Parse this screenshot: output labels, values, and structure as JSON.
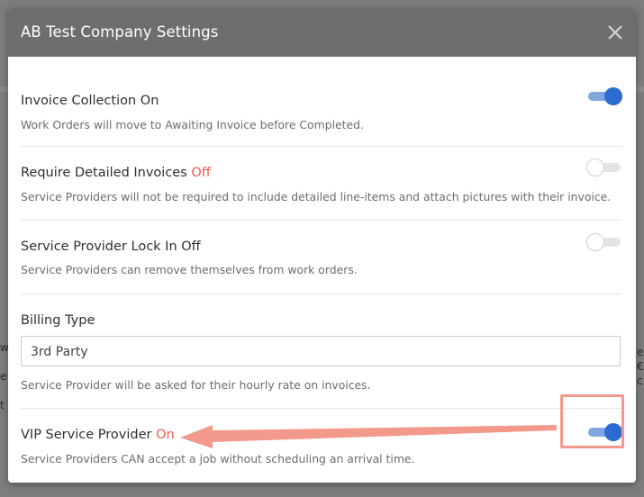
{
  "modal": {
    "title": "AB Test Company Settings",
    "close_icon": "close-x-icon"
  },
  "settings": [
    {
      "title": "Invoice Collection On",
      "status": "",
      "description": "Work Orders will move to Awaiting Invoice before Completed.",
      "enabled": true
    },
    {
      "title": "Require Detailed Invoices",
      "status": "Off",
      "description": "Service Providers will not be required to include detailed line-items and attach pictures with their invoice.",
      "enabled": false
    },
    {
      "title": "Service Provider Lock In Off",
      "status": "",
      "description": "Service Providers can remove themselves from work orders.",
      "enabled": false
    }
  ],
  "billing": {
    "title": "Billing Type",
    "selected": "3rd Party",
    "description": "Service Provider will be asked for their hourly rate on invoices."
  },
  "vip": {
    "title": "VIP Service Provider",
    "status": "On",
    "description": "Service Providers CAN accept a job without scheduling an arrival time.",
    "enabled": true
  },
  "colors": {
    "header_bg": "#6e6e6e",
    "toggle_on": "#2c6bd2",
    "status_text": "#f05a4f",
    "annotation": "#f2998b"
  }
}
